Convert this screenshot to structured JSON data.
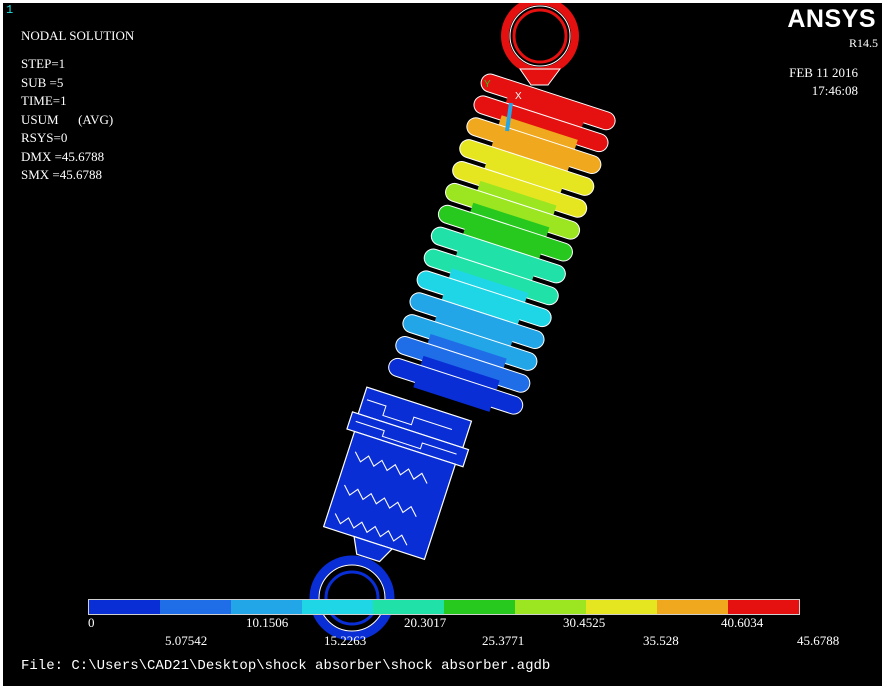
{
  "window_number": "1",
  "brand": "ANSYS",
  "release": "R14.5",
  "date": "FEB 11 2016",
  "time": "17:46:08",
  "info_lines": {
    "title": "NODAL SOLUTION",
    "step": "STEP=1",
    "sub": "SUB =5",
    "time": "TIME=1",
    "usum": "USUM      (AVG)",
    "rsys": "RSYS=0",
    "dmx": "DMX =45.6788",
    "smx": "SMX =45.6788"
  },
  "triad": {
    "y_label": "Y",
    "x_label": "X"
  },
  "legend": {
    "colors": [
      "#0a2ed6",
      "#1f6ee8",
      "#22a6e8",
      "#1fd6e6",
      "#20e2a8",
      "#27c91e",
      "#9be620",
      "#e6e620",
      "#f0a81e",
      "#e51010"
    ],
    "ticks_top": [
      "0",
      "10.1506",
      "20.3017",
      "30.4525",
      "40.6034"
    ],
    "ticks_bottom": [
      "5.07542",
      "15.2263",
      "25.3771",
      "35.528",
      "45.6788"
    ]
  },
  "file_path": "File: C:\\Users\\CAD21\\Desktop\\shock absorber\\shock absorber.agdb"
}
